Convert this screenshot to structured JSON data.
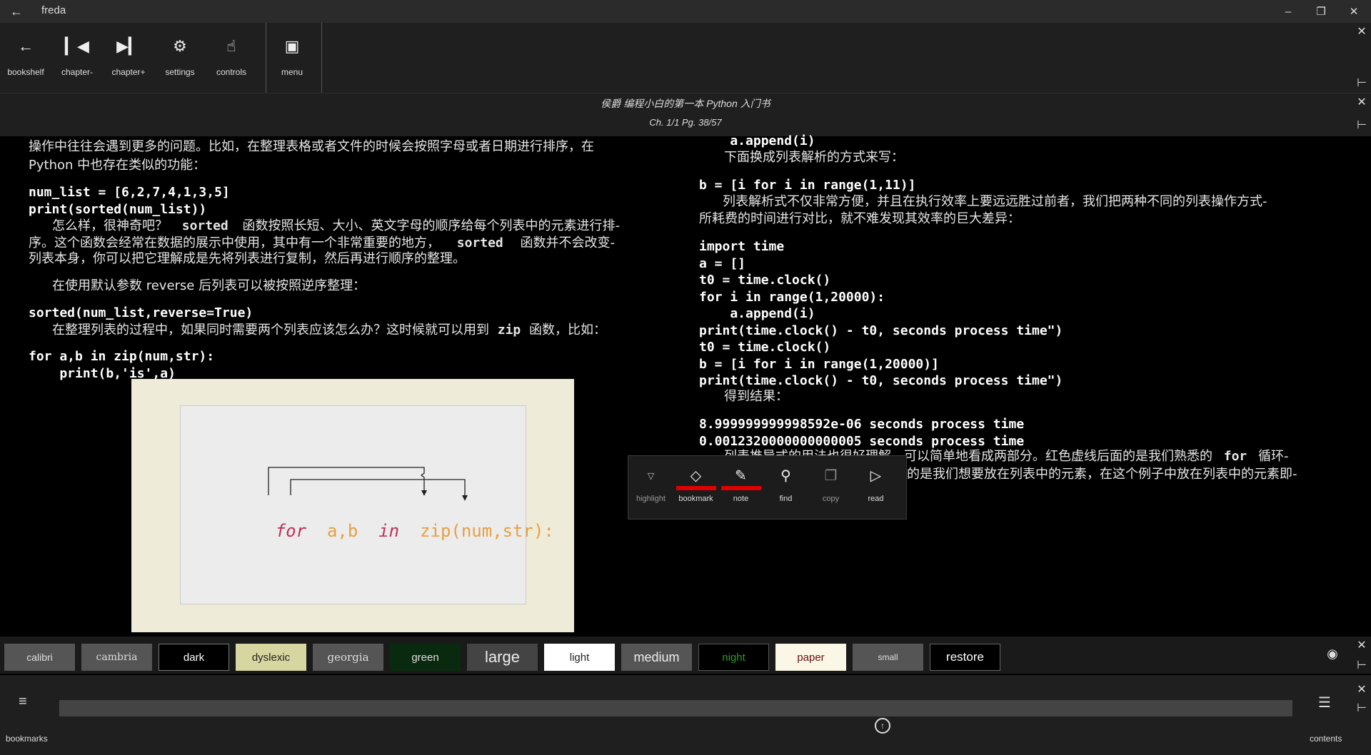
{
  "window": {
    "title": "freda"
  },
  "toolbar": {
    "items": [
      {
        "label": "bookshelf",
        "icon": "arrow-left-icon"
      },
      {
        "label": "chapter-",
        "icon": "skip-previous-icon"
      },
      {
        "label": "chapter+",
        "icon": "skip-next-icon"
      },
      {
        "label": "settings",
        "icon": "gear-icon"
      },
      {
        "label": "controls",
        "icon": "touch-hand-icon"
      },
      {
        "label": "menu",
        "icon": "keyboard-icon"
      }
    ]
  },
  "header": {
    "book_title": "侯爵  编程小白的第一本 Python 入门书",
    "page_info": "Ch. 1/1 Pg. 38/57"
  },
  "left_column": {
    "p1a": "操作中往往会遇到更多的问题。比如，在整理表格或者文件的时候会按照字母或者日期进行排序，在",
    "p1b": "Python 中也存在类似的功能：",
    "code1": "num_list = [6,2,7,4,1,3,5]\nprint(sorted(num_list))",
    "p2a_pre": "怎么样，很神奇吧？",
    "p2a_kw": "sorted",
    "p2a_post": "函数按照长短、大小、英文字母的顺序给每个列表中的元素进行排-",
    "p2b_pre": "序。这个函数会经常在数据的展示中使用，其中有一个非常重要的地方，",
    "p2b_kw": "sorted",
    "p2b_post": "函数并不会改变-",
    "p2c": "列表本身，你可以把它理解成是先将列表进行复制，然后再进行顺序的整理。",
    "p3": "在使用默认参数 reverse 后列表可以被按照逆序整理：",
    "code2": "sorted(num_list,reverse=True)",
    "p4_pre": "在整理列表的过程中，如果同时需要两个列表应该怎么办？这时候就可以用到",
    "p4_kw": "zip",
    "p4_post": "函数，比如：",
    "code3": "for a,b in zip(num,str):\n    print(b,'is',a)"
  },
  "figure": {
    "kw_for": "for",
    "vars": "a,b",
    "kw_in": "in",
    "call": "zip(num,str):"
  },
  "right_column": {
    "code_top": "    a.append(i)",
    "p1": "下面换成列表解析的方式来写：",
    "code1": "b = [i for i in range(1,11)]",
    "p2a": "列表解析式不仅非常方便，并且在执行效率上要远远胜过前者，我们把两种不同的列表操作方式-",
    "p2b": "所耗费的时间进行对比，就不难发现其效率的巨大差异：",
    "code2": "import time\na = []\nt0 = time.clock()\nfor i in range(1,20000):\n    a.append(i)\nprint(time.clock() - t0, seconds process time\")\nt0 = time.clock()\nb = [i for i in range(1,20000)]\nprint(time.clock() - t0, seconds process time\")",
    "p3": "得到结果：",
    "code3": "8.999999999998592e-06 seconds process time\n0.0012320000000000005 seconds process time",
    "p4a_pre": "列表推导式的用法也很好理解，可以简单地看成两部分。红色虚线后面的是我们熟悉的",
    "p4a_kw": "for",
    "p4a_post": "循环-",
    "p4b": "的是我们想要放在列表中的元素，在这个例子中放在列表中的元素即-"
  },
  "popup": {
    "items": [
      {
        "label": "highlight",
        "icon": "highlighter-icon",
        "mark": ""
      },
      {
        "label": "bookmark",
        "icon": "diamond-icon",
        "mark": "#e00000"
      },
      {
        "label": "note",
        "icon": "pencil-icon",
        "mark": "#e00000"
      },
      {
        "label": "find",
        "icon": "magnifier-icon",
        "mark": ""
      },
      {
        "label": "copy",
        "icon": "copy-icon",
        "mark": ""
      },
      {
        "label": "read",
        "icon": "play-icon",
        "mark": ""
      }
    ]
  },
  "themes": {
    "buttons": [
      "calibri",
      "cambria",
      "dark",
      "dyslexic",
      "georgia",
      "green",
      "large",
      "light",
      "medium",
      "night",
      "paper",
      "small",
      "restore"
    ]
  },
  "bottom": {
    "bookmarks_label": "bookmarks",
    "contents_label": "contents"
  },
  "colors": {
    "figure_keyword": "#c0305a",
    "figure_text": "#e8a040",
    "popup_mark": "#e00000"
  }
}
